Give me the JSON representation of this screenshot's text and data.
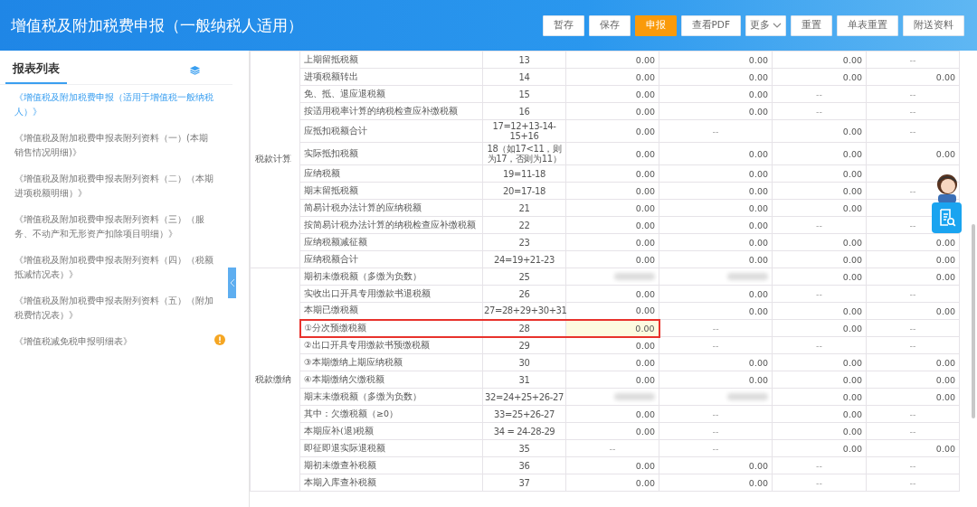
{
  "header": {
    "title": "增值税及附加税费申报（一般纳税人适用）",
    "buttons": [
      {
        "label": "暂存",
        "kind": "normal"
      },
      {
        "label": "保存",
        "kind": "normal"
      },
      {
        "label": "申报",
        "kind": "primary"
      },
      {
        "label": "查看PDF",
        "kind": "normal"
      },
      {
        "label": "更多",
        "kind": "dropdown"
      },
      {
        "label": "重置",
        "kind": "normal"
      },
      {
        "label": "单表重置",
        "kind": "normal"
      },
      {
        "label": "附送资料",
        "kind": "normal"
      }
    ]
  },
  "sidebar": {
    "title": "报表列表",
    "items": [
      {
        "label": "《增值税及附加税费申报（适用于增值税一般纳税人）》",
        "selected": true,
        "warning": false
      },
      {
        "label": "《增值税及附加税费申报表附列资料（一）(本期销售情况明细)》",
        "selected": false,
        "warning": false
      },
      {
        "label": "《增值税及附加税费申报表附列资料（二）（本期进项税额明细）》",
        "selected": false,
        "warning": false
      },
      {
        "label": "《增值税及附加税费申报表附列资料（三）（服务、不动产和无形资产扣除项目明细）》",
        "selected": false,
        "warning": false
      },
      {
        "label": "《增值税及附加税费申报表附列资料（四）（税额抵减情况表）》",
        "selected": false,
        "warning": false
      },
      {
        "label": "《增值税及附加税费申报表附列资料（五）（附加税费情况表）》",
        "selected": false,
        "warning": false
      },
      {
        "label": "《增值税减免税申报明细表》",
        "selected": false,
        "warning": true
      }
    ]
  },
  "table": {
    "sections": [
      {
        "label": "税款计算",
        "rows": [
          {
            "item": "上期留抵税额",
            "line": "13",
            "selected": false,
            "cells": [
              {
                "text": "0.00",
                "kind": "number"
              },
              {
                "text": "0.00",
                "kind": "number"
              },
              {
                "text": "0.00",
                "kind": "number"
              },
              {
                "text": "--",
                "kind": "none"
              }
            ]
          },
          {
            "item": "进项税额转出",
            "line": "14",
            "selected": false,
            "cells": [
              {
                "text": "0.00",
                "kind": "number"
              },
              {
                "text": "0.00",
                "kind": "number"
              },
              {
                "text": "0.00",
                "kind": "number"
              },
              {
                "text": "0.00",
                "kind": "number"
              }
            ]
          },
          {
            "item": "免、抵、退应退税额",
            "line": "15",
            "selected": false,
            "cells": [
              {
                "text": "0.00",
                "kind": "number"
              },
              {
                "text": "0.00",
                "kind": "number"
              },
              {
                "text": "--",
                "kind": "none"
              },
              {
                "text": "--",
                "kind": "none"
              }
            ]
          },
          {
            "item": "按适用税率计算的纳税检查应补缴税额",
            "line": "16",
            "selected": false,
            "cells": [
              {
                "text": "0.00",
                "kind": "number"
              },
              {
                "text": "0.00",
                "kind": "number"
              },
              {
                "text": "--",
                "kind": "none"
              },
              {
                "text": "--",
                "kind": "none"
              }
            ]
          },
          {
            "item": "应抵扣税额合计",
            "line": "17=12+13-14-15+16",
            "selected": false,
            "cells": [
              {
                "text": "0.00",
                "kind": "number"
              },
              {
                "text": "--",
                "kind": "none"
              },
              {
                "text": "0.00",
                "kind": "number"
              },
              {
                "text": "--",
                "kind": "none"
              }
            ]
          },
          {
            "item": "实际抵扣税额",
            "line": "18（如17<11，则为17，否则为11）",
            "selected": false,
            "cells": [
              {
                "text": "0.00",
                "kind": "number"
              },
              {
                "text": "0.00",
                "kind": "number"
              },
              {
                "text": "0.00",
                "kind": "number"
              },
              {
                "text": "0.00",
                "kind": "number"
              }
            ]
          },
          {
            "item": "应纳税额",
            "line": "19=11-18",
            "selected": false,
            "cells": [
              {
                "text": "0.00",
                "kind": "number"
              },
              {
                "text": "0.00",
                "kind": "number"
              },
              {
                "text": "0.00",
                "kind": "number"
              },
              {
                "kind": "covered"
              }
            ]
          },
          {
            "item": "期末留抵税额",
            "line": "20=17-18",
            "selected": false,
            "cells": [
              {
                "text": "0.00",
                "kind": "number"
              },
              {
                "text": "0.00",
                "kind": "number"
              },
              {
                "text": "0.00",
                "kind": "number"
              },
              {
                "text": "--",
                "kind": "none"
              }
            ]
          },
          {
            "item": "简易计税办法计算的应纳税额",
            "line": "21",
            "selected": false,
            "cells": [
              {
                "text": "0.00",
                "kind": "number"
              },
              {
                "text": "0.00",
                "kind": "number"
              },
              {
                "text": "0.00",
                "kind": "number"
              },
              {
                "kind": "covered"
              }
            ]
          },
          {
            "item": "按简易计税办法计算的纳税检查应补缴税额",
            "line": "22",
            "selected": false,
            "cells": [
              {
                "text": "0.00",
                "kind": "number"
              },
              {
                "text": "0.00",
                "kind": "number"
              },
              {
                "text": "--",
                "kind": "none"
              },
              {
                "text": "--",
                "kind": "none"
              }
            ]
          },
          {
            "item": "应纳税额减征额",
            "line": "23",
            "selected": false,
            "cells": [
              {
                "text": "0.00",
                "kind": "number"
              },
              {
                "text": "0.00",
                "kind": "number"
              },
              {
                "text": "0.00",
                "kind": "number"
              },
              {
                "text": "0.00",
                "kind": "number"
              }
            ]
          },
          {
            "item": "应纳税额合计",
            "line": "24=19+21-23",
            "selected": false,
            "cells": [
              {
                "text": "0.00",
                "kind": "number"
              },
              {
                "text": "0.00",
                "kind": "number"
              },
              {
                "text": "0.00",
                "kind": "number"
              },
              {
                "text": "0.00",
                "kind": "number"
              }
            ]
          }
        ]
      },
      {
        "label": "税款缴纳",
        "rows": [
          {
            "item": "期初未缴税额（多缴为负数）",
            "line": "25",
            "selected": false,
            "cells": [
              {
                "kind": "redacted"
              },
              {
                "kind": "redacted"
              },
              {
                "text": "0.00",
                "kind": "number"
              },
              {
                "text": "0.00",
                "kind": "number"
              }
            ]
          },
          {
            "item": "实收出口开具专用缴款书退税额",
            "line": "26",
            "selected": false,
            "cells": [
              {
                "text": "0.00",
                "kind": "number"
              },
              {
                "text": "0.00",
                "kind": "number"
              },
              {
                "text": "--",
                "kind": "none"
              },
              {
                "text": "--",
                "kind": "none"
              }
            ]
          },
          {
            "item": "本期已缴税额",
            "line": "27=28+29+30+31",
            "selected": false,
            "cells": [
              {
                "text": "0.00",
                "kind": "number"
              },
              {
                "text": "0.00",
                "kind": "number"
              },
              {
                "text": "0.00",
                "kind": "number"
              },
              {
                "text": "0.00",
                "kind": "number"
              }
            ]
          },
          {
            "item": "①分次预缴税额",
            "line": "28",
            "selected": true,
            "cells": [
              {
                "text": "0.00",
                "kind": "number"
              },
              {
                "text": "--",
                "kind": "none"
              },
              {
                "text": "0.00",
                "kind": "number"
              },
              {
                "text": "--",
                "kind": "none"
              }
            ]
          },
          {
            "item": "②出口开具专用缴款书预缴税额",
            "line": "29",
            "selected": false,
            "cells": [
              {
                "text": "0.00",
                "kind": "number"
              },
              {
                "text": "--",
                "kind": "none"
              },
              {
                "text": "--",
                "kind": "none"
              },
              {
                "text": "--",
                "kind": "none"
              }
            ]
          },
          {
            "item": "③本期缴纳上期应纳税额",
            "line": "30",
            "selected": false,
            "cells": [
              {
                "text": "0.00",
                "kind": "number"
              },
              {
                "text": "0.00",
                "kind": "number"
              },
              {
                "text": "0.00",
                "kind": "number"
              },
              {
                "text": "0.00",
                "kind": "number"
              }
            ]
          },
          {
            "item": "④本期缴纳欠缴税额",
            "line": "31",
            "selected": false,
            "cells": [
              {
                "text": "0.00",
                "kind": "number"
              },
              {
                "text": "0.00",
                "kind": "number"
              },
              {
                "text": "0.00",
                "kind": "number"
              },
              {
                "text": "0.00",
                "kind": "number"
              }
            ]
          },
          {
            "item": "期末未缴税额（多缴为负数）",
            "line": "32=24+25+26-27",
            "selected": false,
            "cells": [
              {
                "kind": "redacted"
              },
              {
                "kind": "redacted"
              },
              {
                "text": "0.00",
                "kind": "number"
              },
              {
                "text": "0.00",
                "kind": "number"
              }
            ]
          },
          {
            "item": "其中：欠缴税额（≥0）",
            "line": "33=25+26-27",
            "selected": false,
            "cells": [
              {
                "text": "0.00",
                "kind": "number"
              },
              {
                "text": "--",
                "kind": "none"
              },
              {
                "text": "0.00",
                "kind": "number"
              },
              {
                "text": "--",
                "kind": "none"
              }
            ]
          },
          {
            "item": "本期应补(退)税额",
            "line": "34 = 24-28-29",
            "selected": false,
            "cells": [
              {
                "text": "0.00",
                "kind": "number"
              },
              {
                "text": "--",
                "kind": "none"
              },
              {
                "text": "0.00",
                "kind": "number"
              },
              {
                "text": "--",
                "kind": "none"
              }
            ]
          },
          {
            "item": "即征即退实际退税额",
            "line": "35",
            "selected": false,
            "cells": [
              {
                "text": "--",
                "kind": "none"
              },
              {
                "text": "--",
                "kind": "none"
              },
              {
                "text": "0.00",
                "kind": "number"
              },
              {
                "text": "0.00",
                "kind": "number"
              }
            ]
          },
          {
            "item": "期初未缴查补税额",
            "line": "36",
            "selected": false,
            "cells": [
              {
                "text": "0.00",
                "kind": "number"
              },
              {
                "text": "0.00",
                "kind": "number"
              },
              {
                "text": "--",
                "kind": "none"
              },
              {
                "text": "--",
                "kind": "none"
              }
            ]
          },
          {
            "item": "本期入库查补税额",
            "line": "37",
            "selected": false,
            "cells": [
              {
                "text": "0.00",
                "kind": "number"
              },
              {
                "text": "0.00",
                "kind": "number"
              },
              {
                "text": "--",
                "kind": "none"
              },
              {
                "text": "--",
                "kind": "none"
              }
            ]
          }
        ]
      }
    ]
  }
}
